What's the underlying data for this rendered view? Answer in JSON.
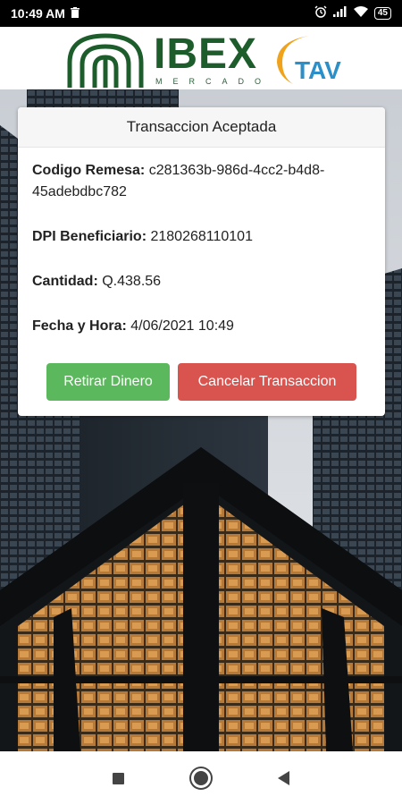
{
  "status_bar": {
    "time": "10:49 AM",
    "battery": "45"
  },
  "header": {
    "brand_main": "IBEX",
    "brand_sub": "MERCADO",
    "brand_partner": "TAV"
  },
  "card": {
    "title": "Transaccion Aceptada",
    "fields": [
      {
        "label": "Codigo Remesa:",
        "value": "c281363b-986d-4cc2-b4d8-45adebdbc782"
      },
      {
        "label": "DPI Beneficiario:",
        "value": "2180268110101"
      },
      {
        "label": "Cantidad:",
        "value": "Q.438.56"
      },
      {
        "label": "Fecha y Hora:",
        "value": "4/06/2021 10:49"
      }
    ],
    "withdraw_button": "Retirar Dinero",
    "cancel_button": "Cancelar Transaccion"
  },
  "colors": {
    "green": "#5cb85c",
    "red": "#d9534f",
    "brand_green": "#1d5c2b",
    "brand_blue": "#2c8fc8",
    "brand_orange": "#f0a21a"
  }
}
